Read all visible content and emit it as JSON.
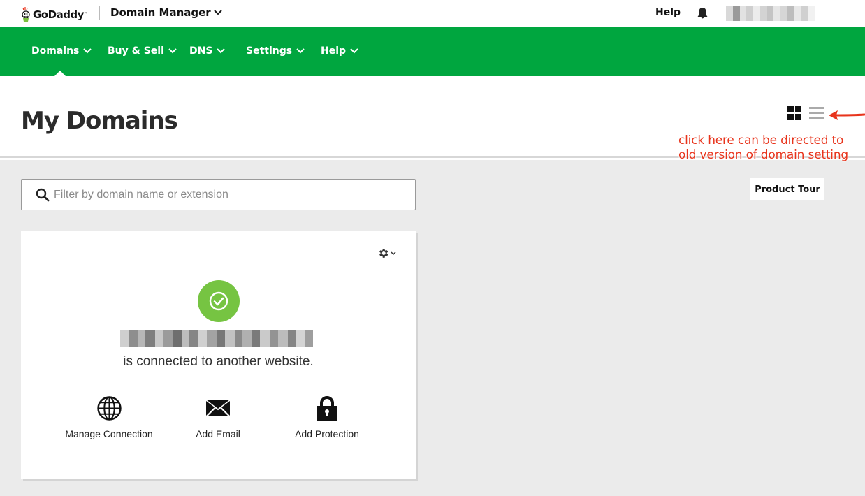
{
  "topbar": {
    "logo_text": "GoDaddy",
    "logo_tm": "™",
    "app_title": "Domain Manager",
    "help_label": "Help"
  },
  "nav": {
    "items": [
      {
        "label": "Domains"
      },
      {
        "label": "Buy & Sell"
      },
      {
        "label": "DNS"
      },
      {
        "label": "Settings"
      },
      {
        "label": "Help"
      }
    ],
    "active": "Domains"
  },
  "page": {
    "title": "My Domains"
  },
  "annotation": {
    "line1": "click here can be directed to",
    "line2": "old version of domain setting"
  },
  "search": {
    "placeholder": "Filter by domain name or extension",
    "value": ""
  },
  "product_tour_label": "Product Tour",
  "card": {
    "status_text": "is connected to another website.",
    "actions": [
      {
        "label": "Manage Connection",
        "icon": "globe-icon"
      },
      {
        "label": "Add Email",
        "icon": "envelope-icon"
      },
      {
        "label": "Add Protection",
        "icon": "lock-icon"
      }
    ]
  },
  "colors": {
    "brand_green": "#00a63f",
    "status_green": "#76c442",
    "annotation_red": "#e8341c",
    "background_gray": "#ebebeb"
  }
}
